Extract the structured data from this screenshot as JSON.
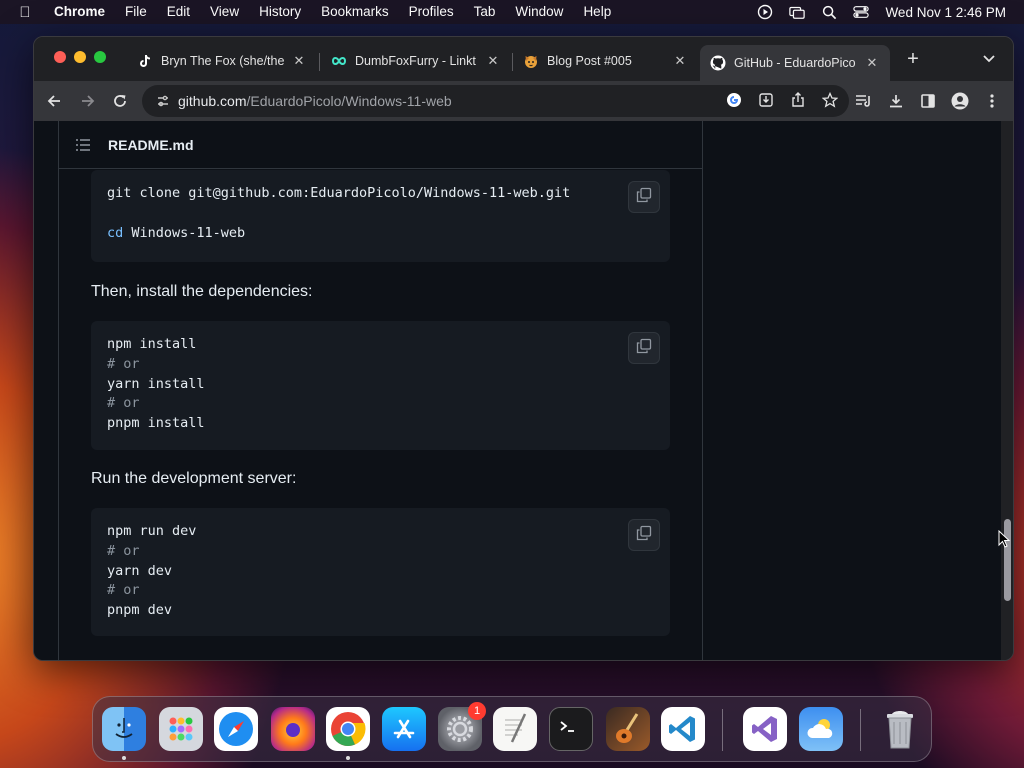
{
  "menubar": {
    "app_name": "Chrome",
    "items": [
      "File",
      "Edit",
      "View",
      "History",
      "Bookmarks",
      "Profiles",
      "Tab",
      "Window",
      "Help"
    ],
    "clock": "Wed Nov 1  2:46 PM"
  },
  "browser": {
    "tabs": [
      {
        "title": "Bryn The Fox (she/the",
        "icon": "tiktok-icon"
      },
      {
        "title": "DumbFoxFurry - Linkt",
        "icon": "linktree-icon"
      },
      {
        "title": "Blog Post #005",
        "icon": "fox-emoji-icon"
      },
      {
        "title": "GitHub - EduardoPico",
        "icon": "github-icon",
        "active": true
      }
    ],
    "url_host": "github.com",
    "url_path": "/EduardoPicolo/Windows-11-web"
  },
  "readme": {
    "filename": "README.md",
    "code1": {
      "line1": "git clone git@github.com:EduardoPicolo/Windows-11-web.git",
      "line2_kw": "cd",
      "line2_rest": " Windows-11-web"
    },
    "para1": "Then, install the dependencies:",
    "code2": {
      "lines": [
        "npm install",
        "# or",
        "yarn install",
        "# or",
        "pnpm install"
      ]
    },
    "para2": "Run the development server:",
    "code3": {
      "lines": [
        "npm run dev",
        "# or",
        "yarn dev",
        "# or",
        "pnpm dev"
      ]
    }
  },
  "dock": {
    "apps": [
      "Finder",
      "Launchpad",
      "Safari",
      "Firefox",
      "Chrome",
      "App Store",
      "System Settings",
      "TextEdit",
      "Terminal",
      "GarageBand",
      "Visual Studio Code",
      "Visual Studio",
      "Weather",
      "Trash"
    ],
    "settings_badge": "1"
  },
  "colors": {
    "page_bg": "#0d1117",
    "code_bg": "#161b22",
    "link": "#4493f8",
    "keyword": "#79c0ff",
    "comment": "#8b949e"
  }
}
